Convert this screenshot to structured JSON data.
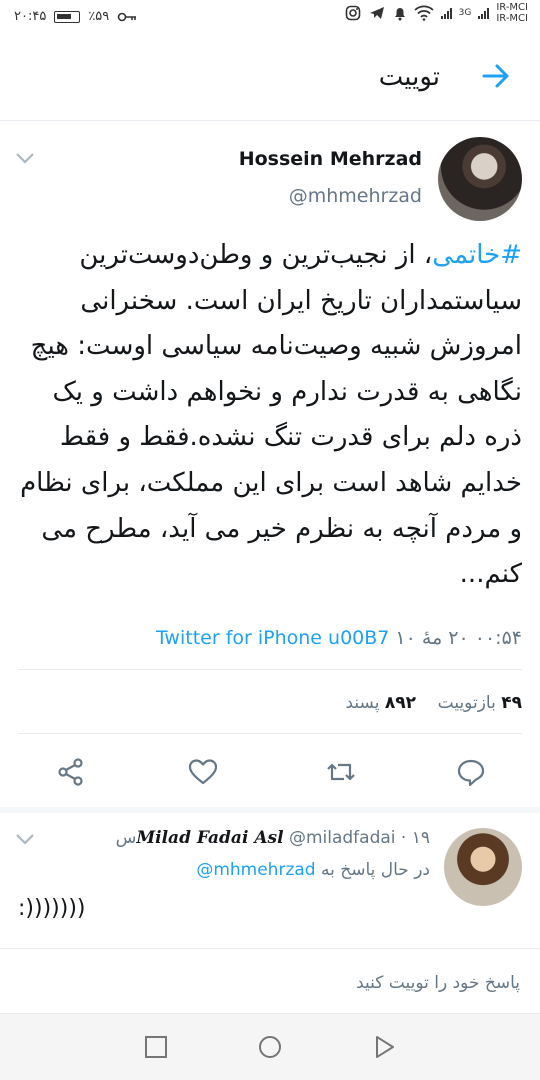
{
  "status_bar": {
    "time": "۲۰:۴۵",
    "battery": "٪۵۹",
    "carrier_1": "IR-MCI",
    "carrier_2": "IR-MCI",
    "network": "3G"
  },
  "header": {
    "title": "توییت"
  },
  "tweet": {
    "display_name": "Hossein Mehrzad",
    "handle": "@mhmehrzad",
    "hashtag": "#خاتمی",
    "body": "، از نجیب‌ترین و وطن‌دوست‌ترین سیاستمداران تاریخ ایران است. سخنرانی امروزش شبیه وصیت‌نامه سیاسی اوست: هیچ نگاهی به قدرت ندارم و نخواهم داشت و یک ذره دلم برای قدرت تنگ نشده.فقط و فقط خدایم شاهد است برای این مملکت، برای نظام و مردم آنچه به نظرم خیر می آید، مطرح می کنم...",
    "time": "۰۰:۵۴",
    "date": "۲۰ مهٔ ۱۰",
    "source": "Twitter for iPhone u00B7",
    "retweets_count": "۴۹",
    "retweets_label": "بازتوییت",
    "likes_count": "۸۹۲",
    "likes_label": "پسند"
  },
  "reply": {
    "display_name": "Milad Fadai Asl",
    "handle": "@miladfadai",
    "age": "· ۱۹س",
    "replying_label": "در حال پاسخ به",
    "replying_to": "@mhmehrzad",
    "text": ":)))))))"
  },
  "composer": {
    "placeholder": "پاسخ خود را توییت کنید"
  },
  "colors": {
    "accent": "#1da1f2",
    "secondary_text": "#657786",
    "primary_text": "#14171a"
  },
  "icons": {
    "back": "arrow-right-icon",
    "caret": "chevron-down-icon",
    "reply": "speech-bubble-icon",
    "retweet": "retweet-icon",
    "like": "heart-icon",
    "share": "share-icon"
  }
}
